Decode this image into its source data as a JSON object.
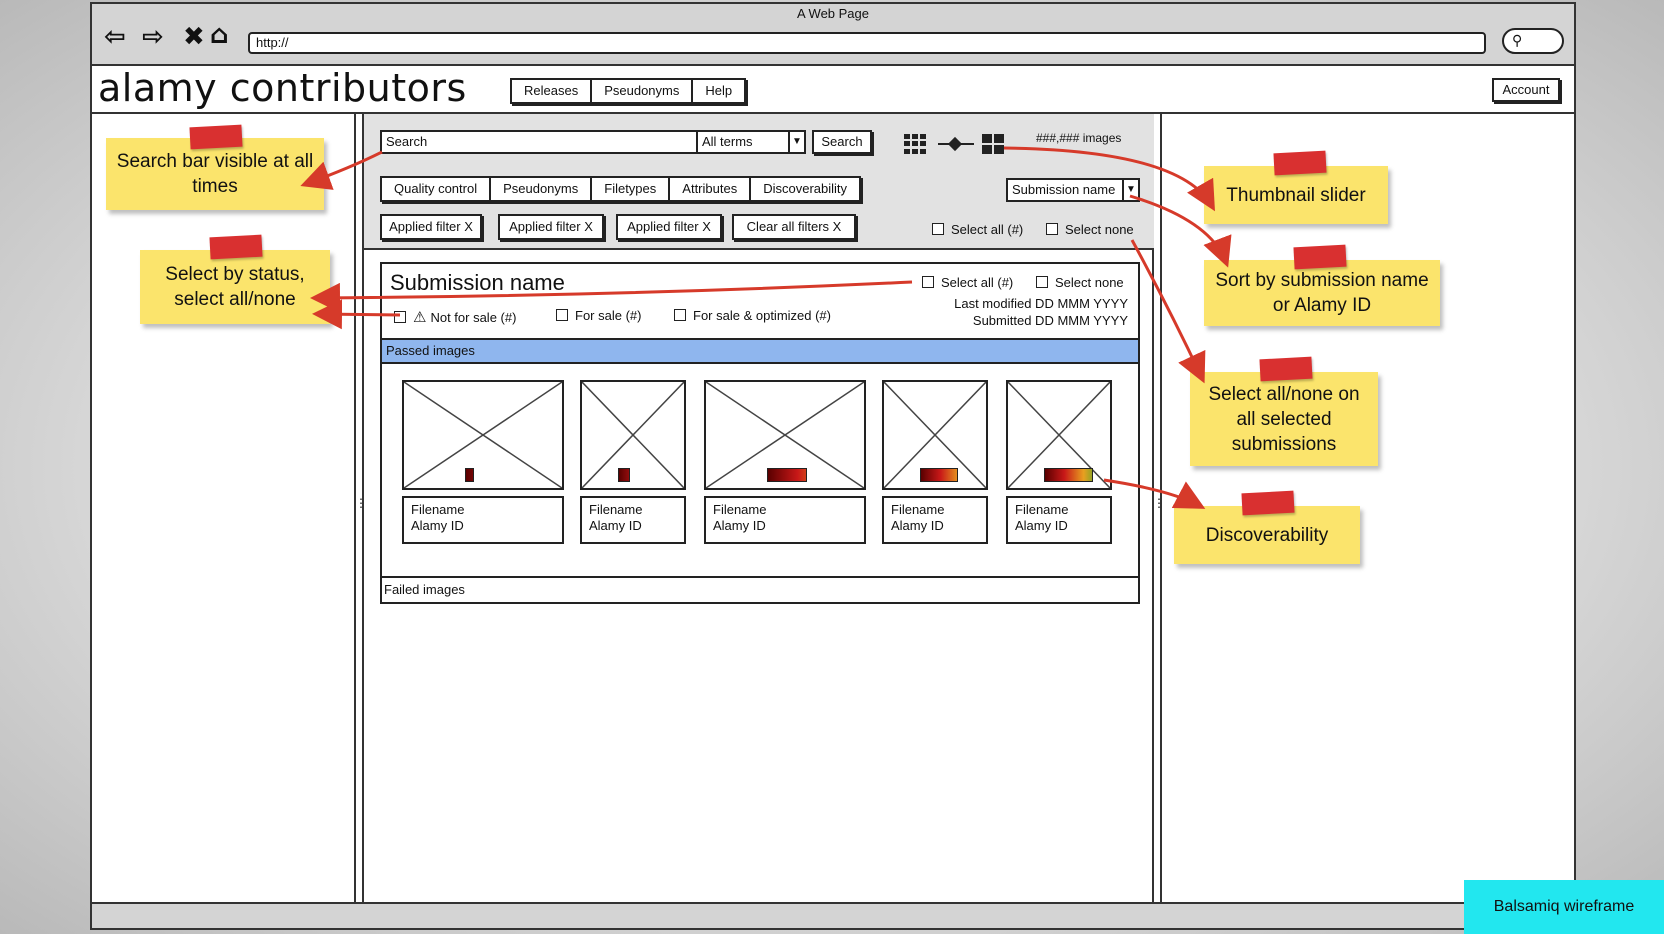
{
  "browser": {
    "window_title": "A Web Page",
    "url": "http://",
    "nav_icons": [
      "back-arrow-icon",
      "forward-arrow-icon",
      "close-x-icon",
      "home-icon"
    ],
    "search_icon_glyph": "⚲"
  },
  "site": {
    "logo_text": "alamy contributors",
    "nav": [
      "Releases",
      "Pseudonyms",
      "Help"
    ],
    "account_label": "Account"
  },
  "toolbar": {
    "search_placeholder": "Search",
    "terms_value": "All terms",
    "search_button": "Search",
    "image_count": "###,### images",
    "filter_tabs": [
      "Quality control",
      "Pseudonyms",
      "Filetypes",
      "Attributes",
      "Discoverability"
    ],
    "sort_value": "Submission name",
    "applied_filters": [
      "Applied filter X",
      "Applied filter X",
      "Applied filter X"
    ],
    "clear_filters": "Clear all filters X",
    "select_all": "Select all (#)",
    "select_none": "Select none"
  },
  "submission": {
    "title": "Submission name",
    "select_all": "Select all (#)",
    "select_none": "Select none",
    "status_filters": [
      "Not for sale (#)",
      "For sale (#)",
      "For sale & optimized (#)"
    ],
    "last_modified": "Last modified DD MMM YYYY",
    "submitted": "Submitted DD MMM YYYY",
    "passed_label": "Passed images",
    "failed_label": "Failed images",
    "images": [
      {
        "filename": "Filename",
        "id": "Alamy ID",
        "discoverability": 0.1
      },
      {
        "filename": "Filename",
        "id": "Alamy ID",
        "discoverability": 0.2
      },
      {
        "filename": "Filename",
        "id": "Alamy ID",
        "discoverability": 0.45
      },
      {
        "filename": "Filename",
        "id": "Alamy ID",
        "discoverability": 0.65
      },
      {
        "filename": "Filename",
        "id": "Alamy ID",
        "discoverability": 0.85
      }
    ]
  },
  "annotations": {
    "search_bar": "Search bar visible at all times",
    "select_status": "Select by status, select all/none",
    "thumbnail_slider": "Thumbnail slider",
    "sort": "Sort by submission name or Alamy ID",
    "select_all_none": "Select all/none on all selected submissions",
    "discoverability": "Discoverability"
  },
  "badge": "Balsamiq wireframe",
  "colors": {
    "note": "#fbe46c",
    "tape": "#d93030",
    "arrow": "#d63a2a",
    "passed_bar": "#8fb6ee",
    "badge": "#22e7ef"
  }
}
